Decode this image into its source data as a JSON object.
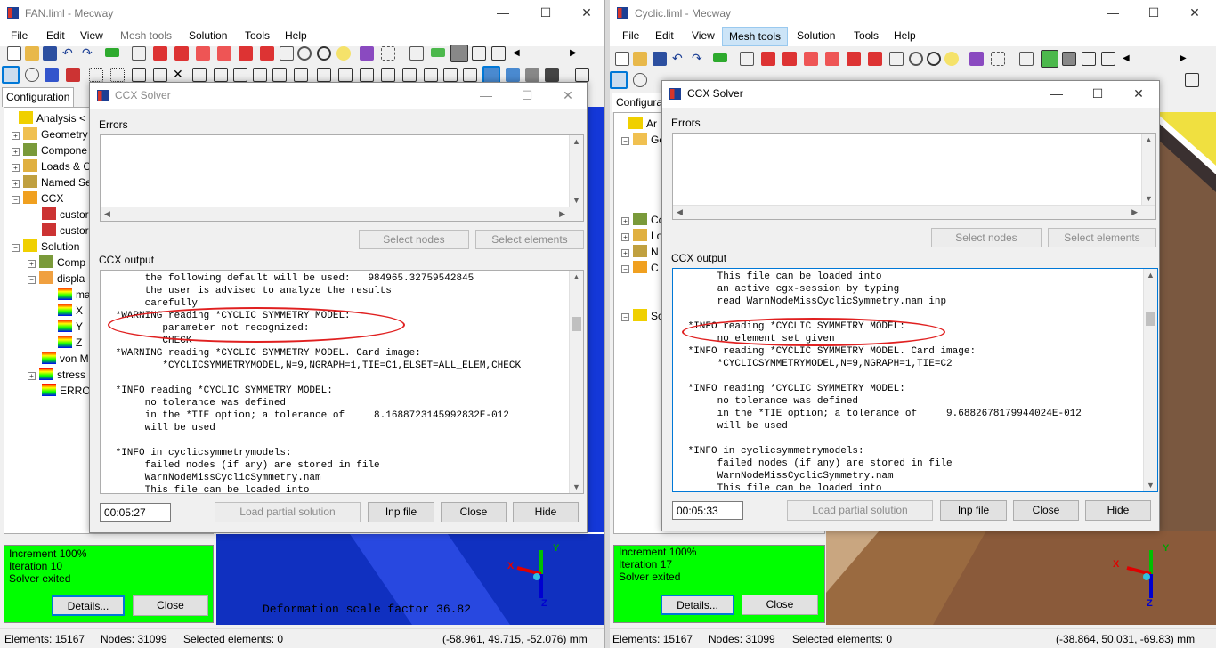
{
  "left_window": {
    "title": "FAN.liml - Mecway",
    "menu": [
      "File",
      "Edit",
      "View",
      "Mesh tools",
      "Solution",
      "Tools",
      "Help"
    ],
    "tab": "Configuration",
    "tree": [
      "Analysis <",
      "Geometry",
      "Compone",
      "Loads & C",
      "Named Se",
      "CCX",
      "custor",
      "custor",
      "Solution",
      "Comp",
      "displa",
      "ma",
      "X",
      "Y",
      "Z",
      "von M",
      "stress",
      "ERROI"
    ],
    "progress": {
      "line1": "Increment 100%",
      "line2": "Iteration 10",
      "line3": "Solver exited",
      "details": "Details...",
      "close": "Close"
    },
    "viewport_text": "Deformation scale factor 36.82",
    "axes": {
      "x": "X",
      "y": "Y",
      "z": "Z"
    },
    "status": {
      "elements": "Elements: 15167",
      "nodes": "Nodes: 31099",
      "selected": "Selected elements: 0",
      "coords": "(-58.961, 49.715, -52.076) mm"
    },
    "dialog": {
      "title": "CCX Solver",
      "errors_label": "Errors",
      "select_nodes": "Select nodes",
      "select_elements": "Select elements",
      "output_label": "CCX output",
      "output": "      the following default will be used:   984965.32759542845\n      the user is advised to analyze the results\n      carefully\n *WARNING reading *CYCLIC SYMMETRY MODEL:\n         parameter not recognized:\n         CHECK\n *WARNING reading *CYCLIC SYMMETRY MODEL. Card image:\n         *CYCLICSYMMETRYMODEL,N=9,NGRAPH=1,TIE=C1,ELSET=ALL_ELEM,CHECK\n\n *INFO reading *CYCLIC SYMMETRY MODEL:\n      no tolerance was defined\n      in the *TIE option; a tolerance of     8.1688723145992832E-012\n      will be used\n\n *INFO in cyclicsymmetrymodels:\n      failed nodes (if any) are stored in file\n      WarnNodeMissCyclicSymmetry.nam\n      This file can be loaded into",
      "timer": "00:05:27",
      "load_partial": "Load partial solution",
      "inp_file": "Inp file",
      "close": "Close",
      "hide": "Hide"
    }
  },
  "right_window": {
    "title": "Cyclic.liml - Mecway",
    "menu": [
      "File",
      "Edit",
      "View",
      "Mesh tools",
      "Solution",
      "Tools",
      "Help"
    ],
    "tab": "Configura",
    "tree": [
      "Ar",
      "Ge",
      "Cc",
      "Lo",
      "N",
      "C",
      "Sc"
    ],
    "progress": {
      "line1": "Increment 100%",
      "line2": "Iteration 17",
      "line3": "Solver exited",
      "details": "Details...",
      "close": "Close"
    },
    "axes": {
      "x": "X",
      "y": "Y",
      "z": "Z"
    },
    "status": {
      "elements": "Elements: 15167",
      "nodes": "Nodes: 31099",
      "selected": "Selected elements: 0",
      "coords": "(-38.864, 50.031, -69.83) mm"
    },
    "dialog": {
      "title": "CCX Solver",
      "errors_label": "Errors",
      "select_nodes": "Select nodes",
      "select_elements": "Select elements",
      "output_label": "CCX output",
      "output": "      This file can be loaded into\n      an active cgx-session by typing\n      read WarnNodeMissCyclicSymmetry.nam inp\n\n *INFO reading *CYCLIC SYMMETRY MODEL:\n      no element set given\n *INFO reading *CYCLIC SYMMETRY MODEL. Card image:\n      *CYCLICSYMMETRYMODEL,N=9,NGRAPH=1,TIE=C2\n\n *INFO reading *CYCLIC SYMMETRY MODEL:\n      no tolerance was defined\n      in the *TIE option; a tolerance of     9.6882678179944024E-012\n      will be used\n\n *INFO in cyclicsymmetrymodels:\n      failed nodes (if any) are stored in file\n      WarnNodeMissCyclicSymmetry.nam\n      This file can be loaded into",
      "timer": "00:05:33",
      "load_partial": "Load partial solution",
      "inp_file": "Inp file",
      "close": "Close",
      "hide": "Hide"
    }
  },
  "colors": {
    "progress_green": "#00ff00",
    "highlight_ellipse": "#e02020",
    "viewport_blue": "#1030d0",
    "viewport_brown": "#8a5a3a",
    "viewport_yellow": "#f0e040"
  }
}
